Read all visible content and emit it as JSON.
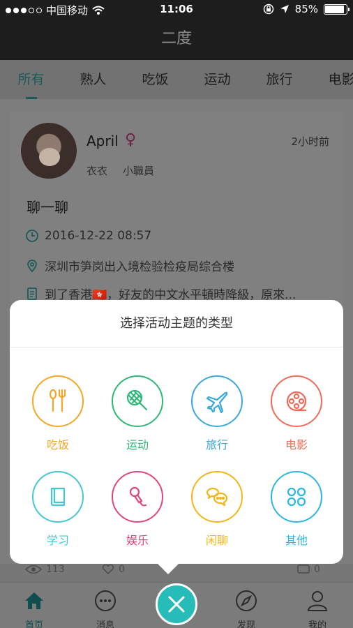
{
  "status_bar": {
    "carrier": "中国移动",
    "time": "11:06",
    "battery": "85%"
  },
  "nav": {
    "title": "二度"
  },
  "tabs": [
    {
      "label": "所有",
      "active": true
    },
    {
      "label": "熟人"
    },
    {
      "label": "吃饭"
    },
    {
      "label": "运动"
    },
    {
      "label": "旅行"
    },
    {
      "label": "电影"
    }
  ],
  "feed": {
    "user_name": "April",
    "gender_symbol": "♀",
    "time_ago": "2小时前",
    "tags": [
      "衣衣",
      "小職員"
    ],
    "title": "聊一聊",
    "datetime": "2016-12-22 08:57",
    "location": "深圳市笋岗出入境检验检疫局综合楼",
    "description": "到了香港🇭🇰，好友的中文水平頓時降級，原來..."
  },
  "feed_stats": {
    "views": "113",
    "likes": "0",
    "comments": "0"
  },
  "sheet": {
    "title": "选择活动主题的类型",
    "items": [
      {
        "label": "吃饭",
        "icon": "fork-spoon-icon",
        "color": "#f5a623"
      },
      {
        "label": "运动",
        "icon": "racket-icon",
        "color": "#2fb779"
      },
      {
        "label": "旅行",
        "icon": "airplane-icon",
        "color": "#3aa7de"
      },
      {
        "label": "电影",
        "icon": "film-reel-icon",
        "color": "#ef6b57"
      },
      {
        "label": "学习",
        "icon": "book-icon",
        "color": "#45c6d1"
      },
      {
        "label": "娱乐",
        "icon": "microphone-icon",
        "color": "#e0457c"
      },
      {
        "label": "闲聊",
        "icon": "chat-bubbles-icon",
        "color": "#f3b61a"
      },
      {
        "label": "其他",
        "icon": "apps-grid-icon",
        "color": "#2bb7e0"
      }
    ]
  },
  "tabbar": [
    {
      "label": "首页",
      "icon": "home-icon",
      "active": true
    },
    {
      "label": "消息",
      "icon": "chat-icon"
    },
    {
      "label": "发现",
      "icon": "compass-icon"
    },
    {
      "label": "我的",
      "icon": "profile-icon"
    }
  ]
}
